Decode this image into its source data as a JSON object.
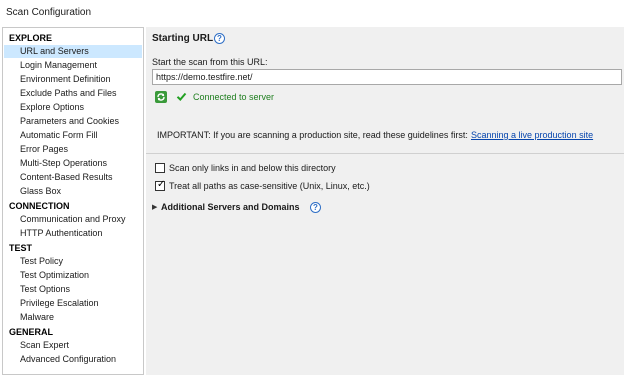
{
  "window": {
    "title": "Scan Configuration"
  },
  "sidebar": {
    "groups": [
      {
        "label": "EXPLORE",
        "items": [
          "URL and Servers",
          "Login Management",
          "Environment Definition",
          "Exclude Paths and Files",
          "Explore Options",
          "Parameters and Cookies",
          "Automatic Form Fill",
          "Error Pages",
          "Multi-Step Operations",
          "Content-Based Results",
          "Glass Box"
        ]
      },
      {
        "label": "CONNECTION",
        "items": [
          "Communication and Proxy",
          "HTTP Authentication"
        ]
      },
      {
        "label": "TEST",
        "items": [
          "Test Policy",
          "Test Optimization",
          "Test Options",
          "Privilege Escalation",
          "Malware"
        ]
      },
      {
        "label": "GENERAL",
        "items": [
          "Scan Expert",
          "Advanced Configuration"
        ]
      }
    ],
    "selected": "URL and Servers"
  },
  "main": {
    "heading": "Starting URL",
    "help_glyph": "?",
    "url_label": "Start the scan from this URL:",
    "url_value": "https://demo.testfire.net/",
    "status_text": "Connected to server",
    "important_text": "IMPORTANT: If you are scanning a production site, read these guidelines first:",
    "important_link": "Scanning a live production site",
    "options": [
      {
        "label": "Scan only links in and below this directory",
        "checked": false
      },
      {
        "label": "Treat all paths as case-sensitive (Unix, Linux, etc.)",
        "checked": true
      }
    ],
    "expander_glyph": "▶",
    "additional_section": "Additional Servers and Domains"
  },
  "colors": {
    "selected_bg": "#cce8ff",
    "link": "#0645ad",
    "success": "#1e7e1e",
    "help_blue": "#2f6fc6"
  }
}
